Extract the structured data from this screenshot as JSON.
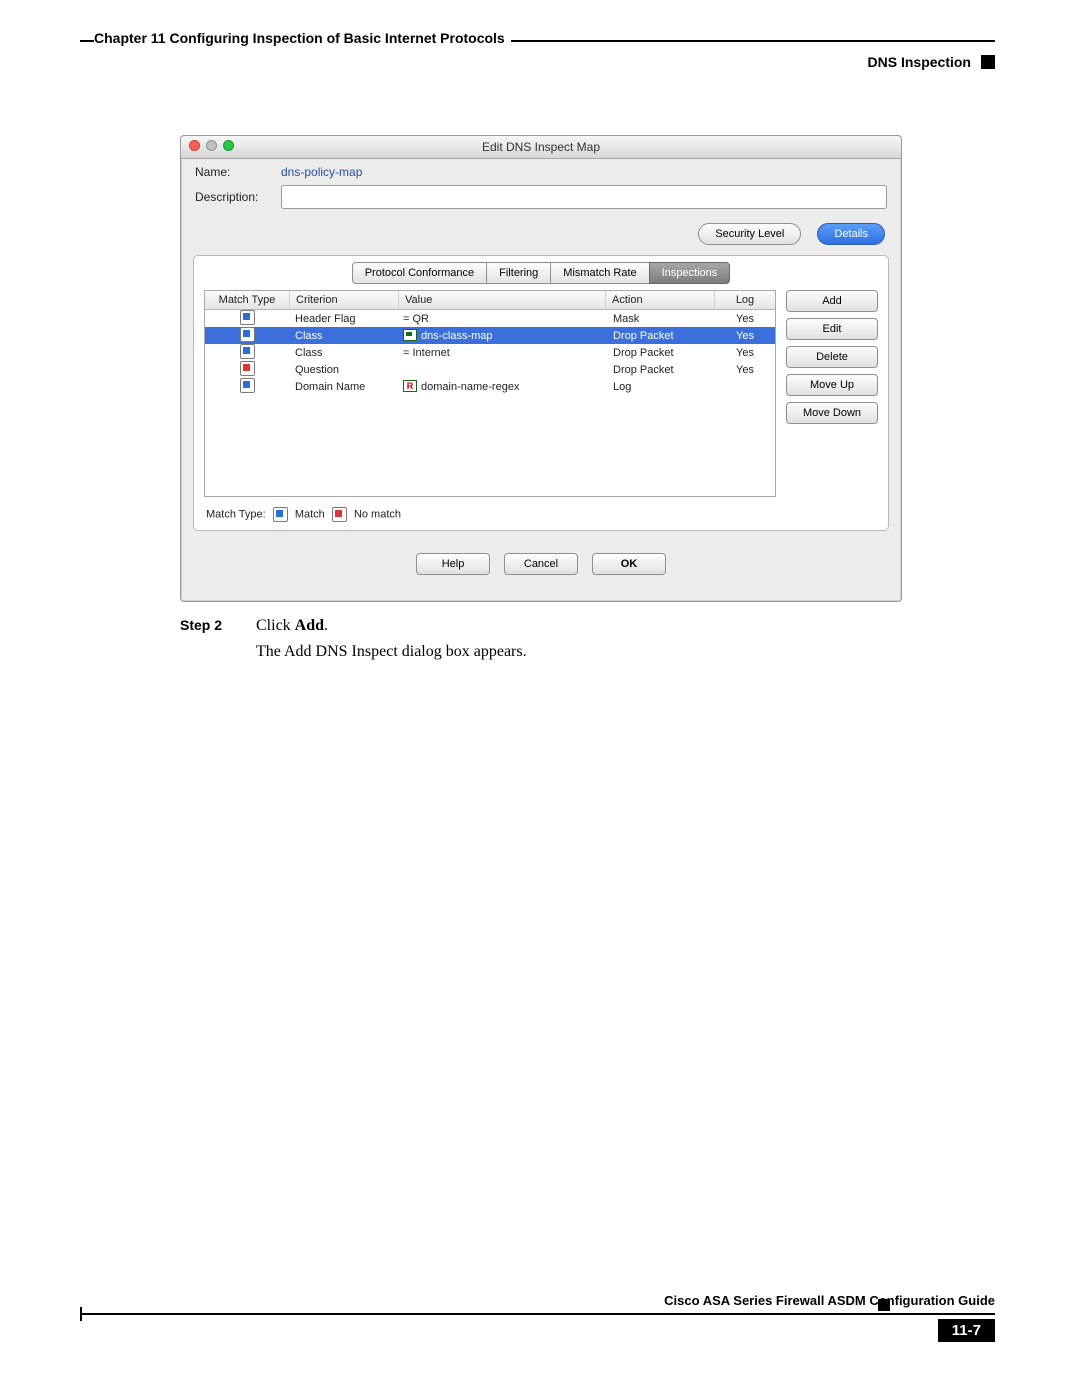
{
  "header": {
    "chapter_line": "Chapter 11    Configuring Inspection of Basic Internet Protocols",
    "section": "DNS Inspection"
  },
  "dialog": {
    "title": "Edit DNS Inspect Map",
    "name_label": "Name:",
    "name_value": "dns-policy-map",
    "desc_label": "Description:",
    "desc_value": "",
    "security_btn": "Security Level",
    "details_btn": "Details",
    "tabs": [
      "Protocol Conformance",
      "Filtering",
      "Mismatch Rate",
      "Inspections"
    ],
    "active_tab_index": 3,
    "columns": {
      "match": "Match Type",
      "criterion": "Criterion",
      "value": "Value",
      "action": "Action",
      "log": "Log"
    },
    "rows": [
      {
        "mt": "match",
        "criterion": "Header Flag",
        "value": "=  QR",
        "action": "Mask",
        "log": "Yes",
        "sel": false,
        "icon": "none"
      },
      {
        "mt": "match",
        "criterion": "Class",
        "value": "dns-class-map",
        "action": "Drop Packet",
        "log": "Yes",
        "sel": true,
        "icon": "box"
      },
      {
        "mt": "match",
        "criterion": "Class",
        "value": "=  Internet",
        "action": "Drop Packet",
        "log": "Yes",
        "sel": false,
        "icon": "none"
      },
      {
        "mt": "nomatch",
        "criterion": "Question",
        "value": "",
        "action": "Drop Packet",
        "log": "Yes",
        "sel": false,
        "icon": "none"
      },
      {
        "mt": "match",
        "criterion": "Domain Name",
        "value": "domain-name-regex",
        "action": "Log",
        "log": "",
        "sel": false,
        "icon": "rbox"
      }
    ],
    "side_buttons": {
      "add": "Add",
      "edit": "Edit",
      "delete": "Delete",
      "moveup": "Move Up",
      "movedown": "Move Down"
    },
    "legend": {
      "prefix": "Match Type:",
      "match": "Match",
      "nomatch": "No match"
    },
    "bottom_buttons": {
      "help": "Help",
      "cancel": "Cancel",
      "ok": "OK"
    }
  },
  "body": {
    "step_label": "Step 2",
    "step_text_a": "Click ",
    "step_text_b": "Add",
    "step_text_c": ".",
    "line2": "The Add DNS Inspect dialog box appears."
  },
  "footer": {
    "guide": "Cisco ASA Series Firewall ASDM Configuration Guide",
    "page": "11-7"
  }
}
